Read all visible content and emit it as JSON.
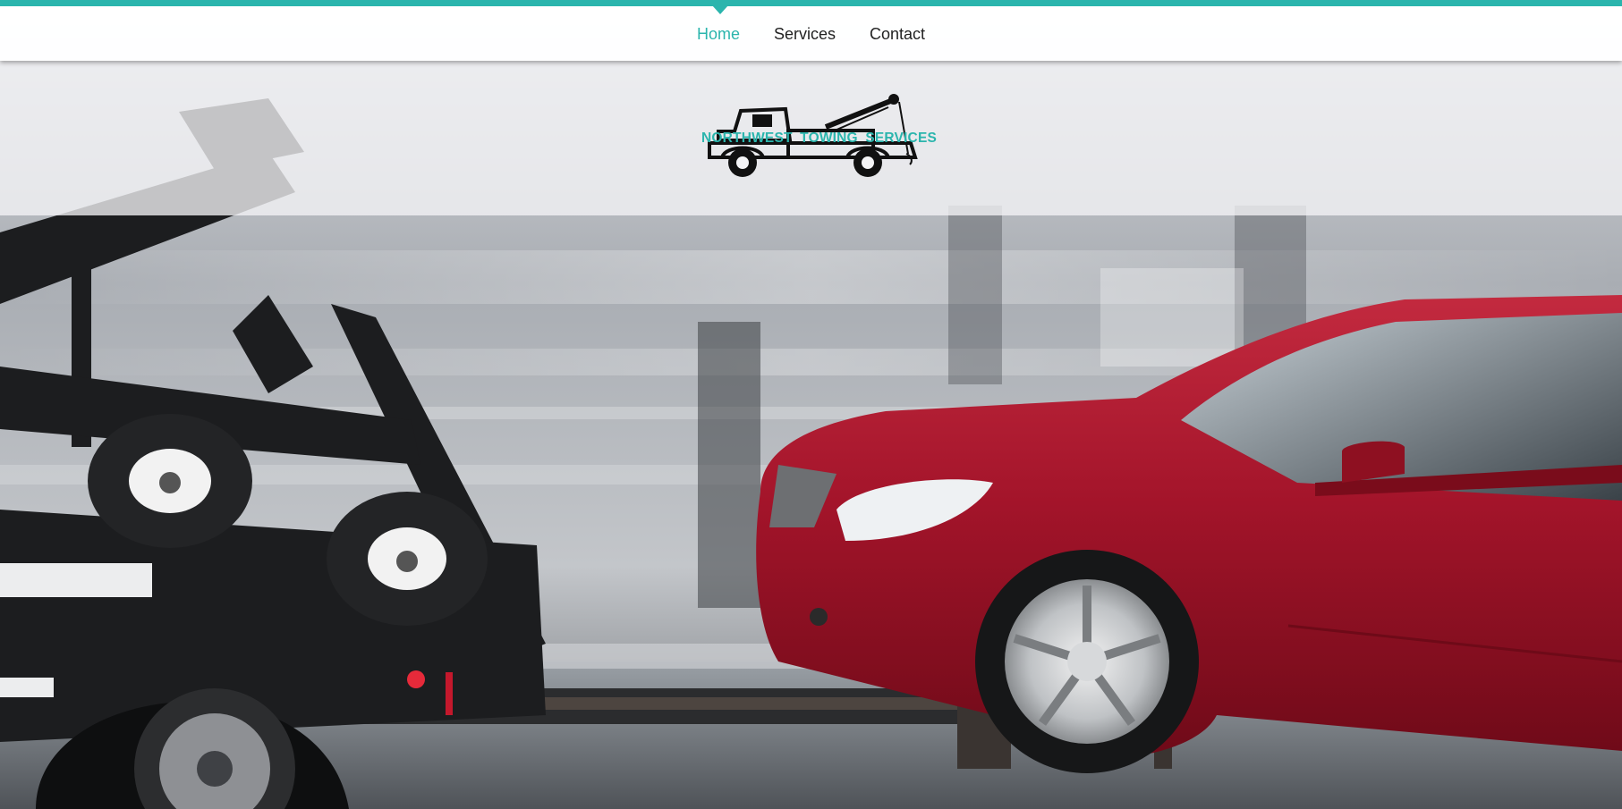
{
  "nav": {
    "items": [
      {
        "label": "Home",
        "active": true
      },
      {
        "label": "Services",
        "active": false
      },
      {
        "label": "Contact",
        "active": false
      }
    ]
  },
  "logo": {
    "text": "NORTHWEST TOWING SERVICES",
    "icon": "tow-truck-icon"
  },
  "hero": {
    "image": "tow-truck-towing-red-car-photo"
  },
  "colors": {
    "accent": "#2bb5ad",
    "car_red": "#a3142a",
    "truck_black": "#1c1d1f"
  }
}
